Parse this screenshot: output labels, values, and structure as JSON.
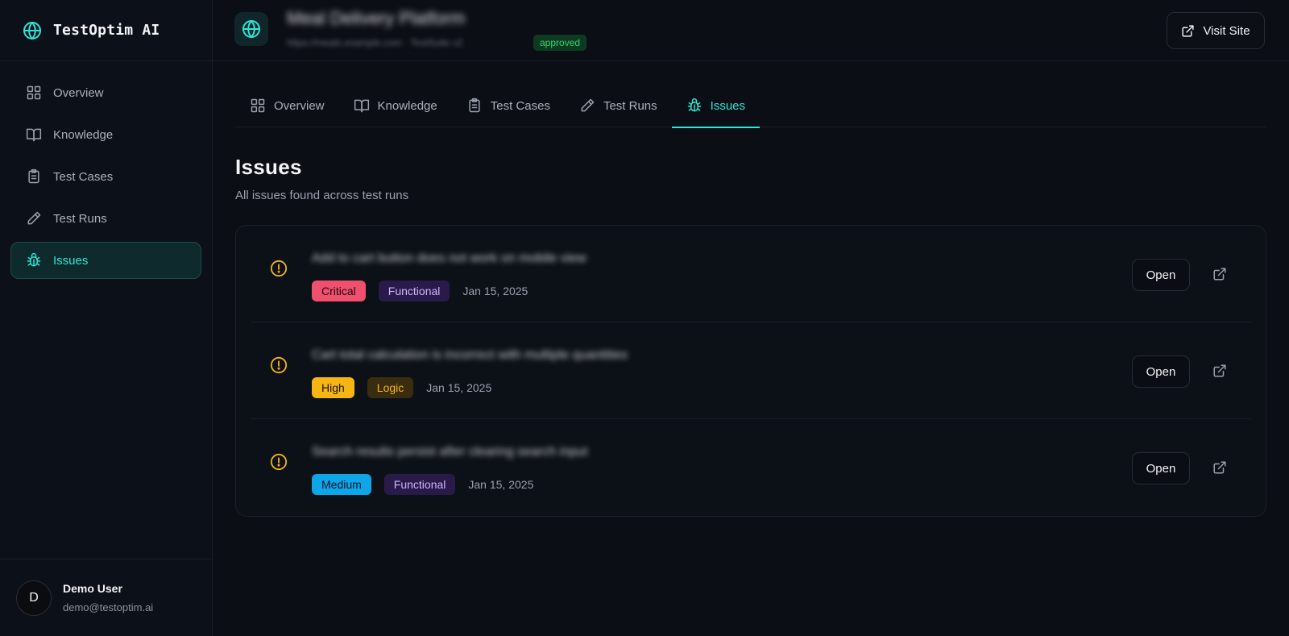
{
  "brand": {
    "name": "TestOptim AI",
    "icon": "globe-icon"
  },
  "sidebar": {
    "items": [
      {
        "label": "Overview",
        "icon": "grid-icon",
        "active": false
      },
      {
        "label": "Knowledge",
        "icon": "book-icon",
        "active": false
      },
      {
        "label": "Test Cases",
        "icon": "clipboard-icon",
        "active": false
      },
      {
        "label": "Test Runs",
        "icon": "pencil-icon",
        "active": false
      },
      {
        "label": "Issues",
        "icon": "bug-icon",
        "active": true
      }
    ]
  },
  "user": {
    "initial": "D",
    "name": "Demo User",
    "email": "demo@testoptim.ai"
  },
  "header": {
    "project_title": "Meal Delivery Platform",
    "project_subtitle": "https://meals.example.com · TestSuite v2",
    "status_badge": "approved",
    "visit_label": "Visit Site"
  },
  "tabs": [
    {
      "label": "Overview",
      "icon": "grid-icon",
      "active": false
    },
    {
      "label": "Knowledge",
      "icon": "book-icon",
      "active": false
    },
    {
      "label": "Test Cases",
      "icon": "clipboard-icon",
      "active": false
    },
    {
      "label": "Test Runs",
      "icon": "pencil-icon",
      "active": false
    },
    {
      "label": "Issues",
      "icon": "bug-icon",
      "active": true
    }
  ],
  "page": {
    "title": "Issues",
    "subtitle": "All issues found across test runs"
  },
  "issues": [
    {
      "title": "Add to cart button does not work on mobile view",
      "severity": "Critical",
      "category": "Functional",
      "date": "Jan 15, 2025",
      "action_label": "Open"
    },
    {
      "title": "Cart total calculation is incorrect with multiple quantities",
      "severity": "High",
      "category": "Logic",
      "date": "Jan 15, 2025",
      "action_label": "Open"
    },
    {
      "title": "Search results persist after clearing search input",
      "severity": "Medium",
      "category": "Functional",
      "date": "Jan 15, 2025",
      "action_label": "Open"
    }
  ],
  "colors": {
    "accent": "#2ee6d6",
    "background": "#0b0e14",
    "critical": "#f0506e",
    "high": "#f5b512",
    "medium": "#0ea5e9",
    "functional": "#2a1a4a",
    "warning_icon": "#f5b512",
    "approved": "#34d26b"
  }
}
